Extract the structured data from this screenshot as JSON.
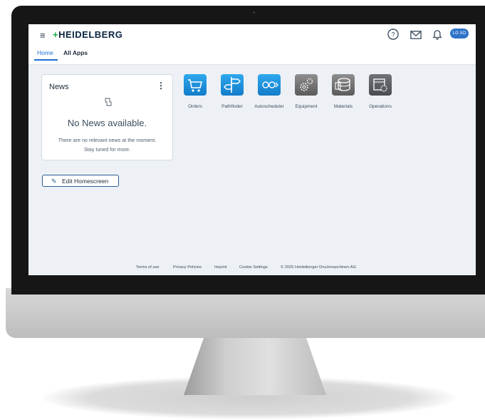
{
  "header": {
    "logo_text": "HEIDELBERG",
    "menu_icon": "hamburger-menu-icon",
    "avatar_text": "LG XO"
  },
  "tabs": [
    {
      "label": "Home",
      "active": true
    },
    {
      "label": "All Apps",
      "active": false
    }
  ],
  "news": {
    "title": "News",
    "empty_title": "No News available.",
    "empty_line1": "There are no relevant news at the moment.",
    "empty_line2": "Stay tuned for more."
  },
  "edit_button": {
    "label": "Edit Homescreen"
  },
  "apps": [
    {
      "label": "Orders",
      "icon": "shopping-cart-icon",
      "color": "#1f95e0"
    },
    {
      "label": "Pathfinder",
      "icon": "signpost-icon",
      "color": "#1f95e0"
    },
    {
      "label": "Autoscheduler",
      "icon": "scheduler-icon",
      "color": "#1f95e0"
    },
    {
      "label": "Equipment",
      "icon": "gears-icon",
      "color": "#7a7a7a"
    },
    {
      "label": "Materials",
      "icon": "materials-stack-icon",
      "color": "#7a7a7a"
    },
    {
      "label": "Operations",
      "icon": "operations-icon",
      "color": "#5e6266"
    }
  ],
  "footer": {
    "terms": "Terms of use",
    "privacy": "Privacy Policies",
    "imprint": "Imprint",
    "cookies": "Cookie Settings",
    "copyright": "© 2025 Heidelberger Druckmaschinen AG"
  },
  "colors": {
    "accent": "#1d6fd1",
    "brand_green": "#1aa64a",
    "screen_bg": "#edf1f5"
  }
}
